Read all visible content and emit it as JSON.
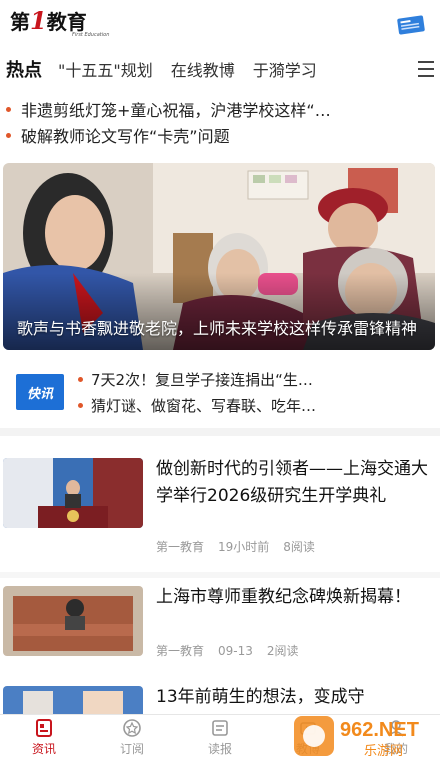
{
  "header": {
    "logo_prefix": "第",
    "logo_mark": "1",
    "logo_suffix": "教育",
    "logo_tagline": "First Education"
  },
  "tabs": [
    {
      "label": "热点",
      "active": true
    },
    {
      "label": "\"十五五\"规划"
    },
    {
      "label": "在线教博"
    },
    {
      "label": "于漪学习"
    }
  ],
  "headlines": [
    "非遗剪纸灯笼+童心祝福，沪港学校这样“…",
    "破解教师论文写作“卡壳”问题"
  ],
  "hero": {
    "caption": "歌声与书香飘进敬老院，上师未来学校这样传承雷锋精神"
  },
  "flash": {
    "logo_text": "快讯",
    "items": [
      "7天2次！复旦学子接连捐出“生…",
      "猜灯谜、做窗花、写春联、吃年…"
    ]
  },
  "articles": [
    {
      "title": "做创新时代的引领者——上海交通大学举行2026级研究生开学典礼",
      "source": "第一教育",
      "time": "19小时前",
      "reads": "8阅读"
    },
    {
      "title": "上海市尊师重教纪念碑焕新揭幕！",
      "source": "第一教育",
      "time": "09-13",
      "reads": "2阅读"
    },
    {
      "title": "13年前萌生的想法，变成守"
    }
  ],
  "bottom_nav": [
    {
      "label": "资讯",
      "icon": "news-icon",
      "active": true
    },
    {
      "label": "订阅",
      "icon": "subscribe-icon"
    },
    {
      "label": "读报",
      "icon": "newspaper-icon"
    },
    {
      "label": "教博",
      "icon": "expo-icon"
    },
    {
      "label": "我的",
      "icon": "profile-icon"
    }
  ],
  "watermark": {
    "top_text": "962.NET",
    "bottom_text": "乐游网"
  },
  "colors": {
    "brand_red": "#c8151d",
    "dot_orange": "#e0572a",
    "flash_blue": "#1d6fd6",
    "meta_gray": "#999999",
    "watermark_orange": "#f28a1c"
  }
}
